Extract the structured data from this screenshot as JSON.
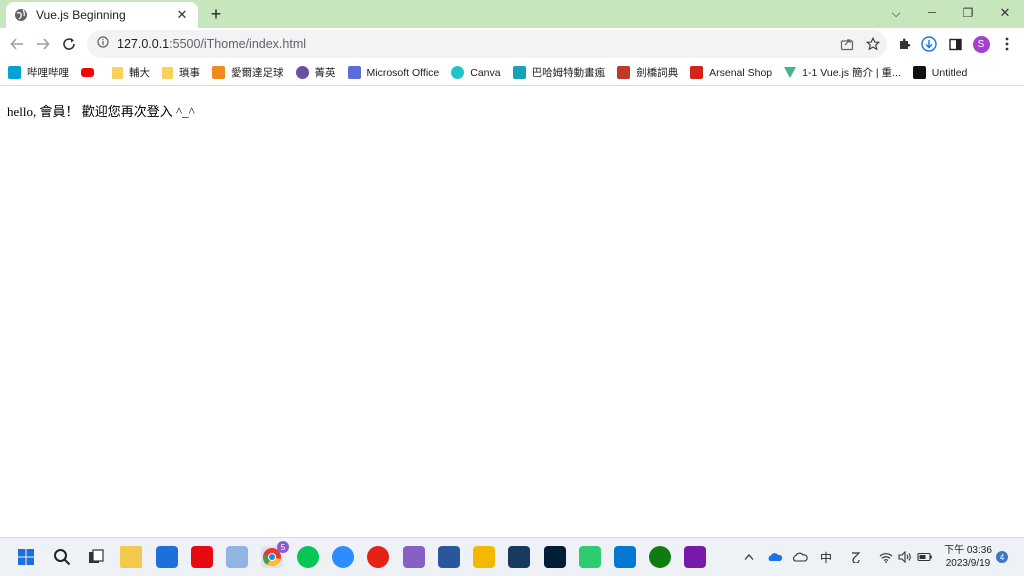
{
  "tab": {
    "title": "Vue.js Beginning",
    "close_label": "✕",
    "new_tab_label": "+"
  },
  "window_controls": {
    "dropdown": "⌵",
    "minimize": "─",
    "restore": "❐",
    "close": "✕"
  },
  "address": {
    "host": "127.0.0.1",
    "rest": ":5500/iThome/index.html"
  },
  "bookmarks": [
    {
      "label": "哔哩哔哩",
      "icon": "bilibili-icon",
      "color": "#00a1d6"
    },
    {
      "label": "",
      "icon": "youtube-icon",
      "color": "#ff0000"
    },
    {
      "label": "輔大",
      "icon": "folder-icon",
      "color": "#f6d35c"
    },
    {
      "label": "瑣事",
      "icon": "folder-icon",
      "color": "#f6d35c"
    },
    {
      "label": "愛爾達足球",
      "icon": "elta-icon",
      "color": "#f28b1e"
    },
    {
      "label": "菁英",
      "icon": "elite-icon",
      "color": "#6b4fa2"
    },
    {
      "label": "Microsoft Office",
      "icon": "office-icon",
      "color": "#5b6dd8"
    },
    {
      "label": "Canva",
      "icon": "canva-icon",
      "color": "#20c4cb"
    },
    {
      "label": "巴哈姆特動畫瘋",
      "icon": "bahamut-icon",
      "color": "#14a3b8"
    },
    {
      "label": "劍橋詞典",
      "icon": "cambridge-icon",
      "color": "#c0392b"
    },
    {
      "label": "Arsenal Shop",
      "icon": "arsenal-icon",
      "color": "#d6221c"
    },
    {
      "label": "1-1 Vue.js 簡介 | 重...",
      "icon": "vue-icon",
      "color": "#41b883"
    },
    {
      "label": "Untitled",
      "icon": "notion-icon",
      "color": "#111111"
    }
  ],
  "page": {
    "message": "hello, 會員！ 歡迎您再次登入 ^_^"
  },
  "taskbar": {
    "apps": [
      {
        "name": "start-icon",
        "color": "#1e6fd9"
      },
      {
        "name": "search-icon",
        "color": "#222222"
      },
      {
        "name": "task-view-icon",
        "color": "#333333"
      },
      {
        "name": "file-explorer-icon",
        "color": "#f2c94c"
      },
      {
        "name": "mail-icon",
        "color": "#1e6fd9"
      },
      {
        "name": "netflix-icon",
        "color": "#e50914"
      },
      {
        "name": "photo-app-icon",
        "color": "#8fb5e0"
      },
      {
        "name": "chrome-icon",
        "color": "#e53935",
        "badge": "5"
      },
      {
        "name": "line-icon",
        "color": "#06c755"
      },
      {
        "name": "zoom-icon",
        "color": "#2d8cff"
      },
      {
        "name": "youtube-music-icon",
        "color": "#e62117"
      },
      {
        "name": "visual-studio-icon",
        "color": "#8661c5"
      },
      {
        "name": "word-app-icon",
        "color": "#2b579a"
      },
      {
        "name": "snip-icon",
        "color": "#f5b800"
      },
      {
        "name": "virtualbox-icon",
        "color": "#183a61"
      },
      {
        "name": "photoshop-icon",
        "color": "#001e36"
      },
      {
        "name": "game-app-icon",
        "color": "#2ecc71"
      },
      {
        "name": "vscode-icon",
        "color": "#0078d4"
      },
      {
        "name": "xbox-icon",
        "color": "#107c10"
      },
      {
        "name": "onenote-icon",
        "color": "#7719aa"
      }
    ],
    "tray_ime": "中",
    "clock_time": "下午 03:36",
    "clock_date": "2023/9/19",
    "notification_count": "4"
  }
}
